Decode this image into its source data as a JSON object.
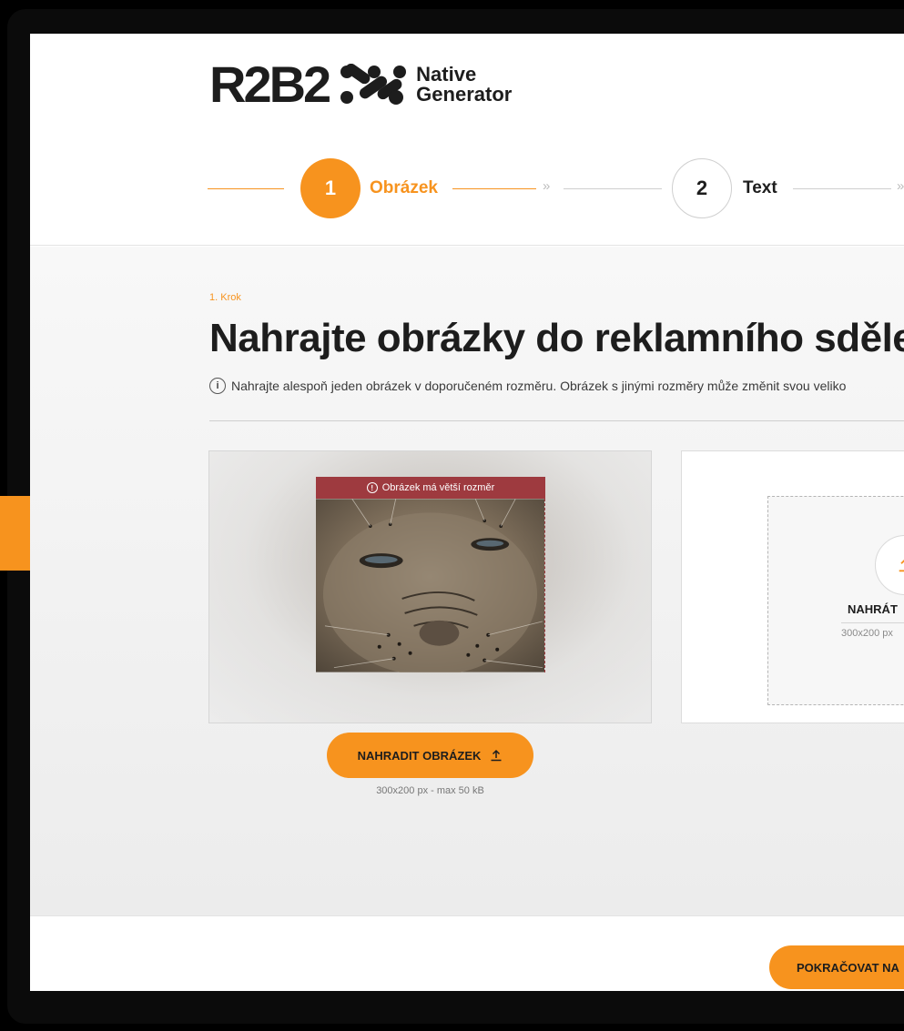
{
  "brand": {
    "name": "R2B2",
    "product_line1": "Native",
    "product_line2": "Generator"
  },
  "stepper": {
    "steps": [
      {
        "number": "1",
        "label": "Obrázek",
        "state": "active"
      },
      {
        "number": "2",
        "label": "Text",
        "state": "idle"
      }
    ],
    "separator": "»"
  },
  "page": {
    "kicker": "1. Krok",
    "title": "Nahrajte obrázky do reklamního sděle",
    "hint": "Nahrajte alespoň jeden obrázek v doporučeném rozměru. Obrázek s jinými rozměry může změnit svou veliko"
  },
  "preview": {
    "warning": "Obrázek má větší rozměr",
    "replace_label": "NAHRADIT OBRÁZEK",
    "size_note": "300x200 px - max 50 kB"
  },
  "upload": {
    "label": "NAHRÁT",
    "size": "300x200 px"
  },
  "footer": {
    "continue_label": "POKRAČOVAT NA"
  },
  "colors": {
    "accent": "#f7931e",
    "warning": "#9e3a3f",
    "text": "#1d1d1d"
  },
  "icons": [
    "info-icon",
    "warning-icon",
    "upload-icon",
    "logo-mark-icon"
  ]
}
